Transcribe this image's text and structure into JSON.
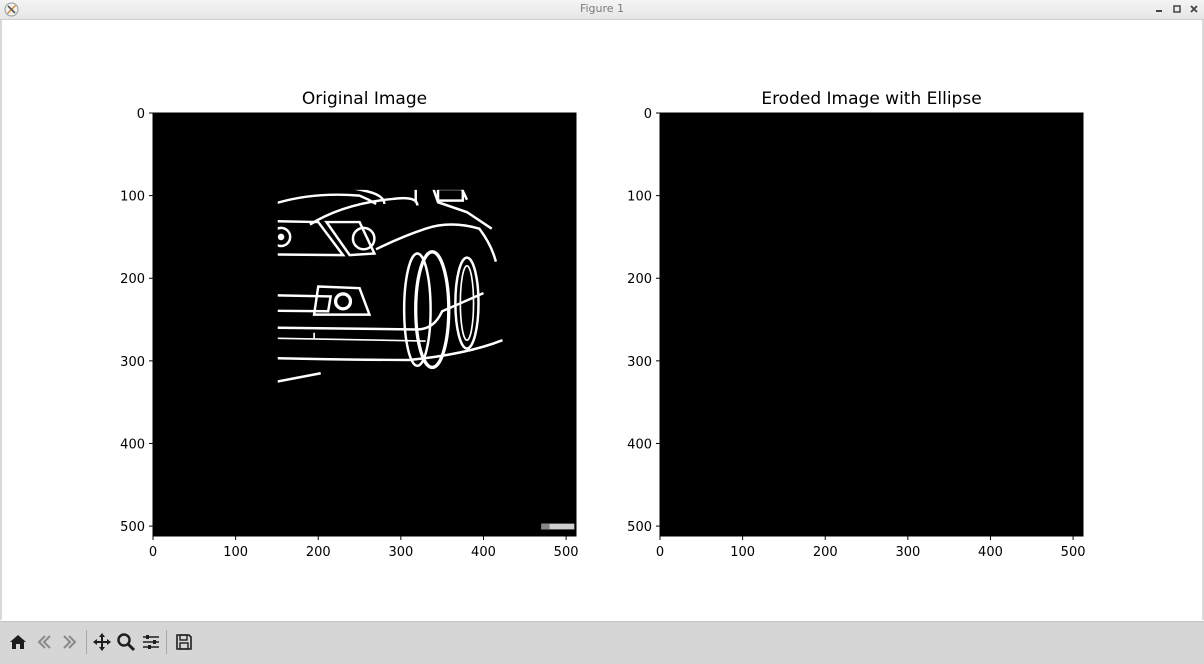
{
  "window": {
    "title": "Figure 1",
    "controls": [
      "minimize-icon",
      "maximize-icon",
      "close-icon"
    ]
  },
  "chart_data": [
    {
      "type": "image",
      "title": "Original Image",
      "xlabel": "",
      "ylabel": "",
      "xlim": [
        0,
        512
      ],
      "ylim": [
        512,
        0
      ],
      "xticks": [
        0,
        100,
        200,
        300,
        400,
        500
      ],
      "yticks": [
        0,
        100,
        200,
        300,
        400,
        500
      ],
      "colormap": "gray"
    },
    {
      "type": "image",
      "title": "Eroded Image with Ellipse",
      "xlabel": "",
      "ylabel": "",
      "xlim": [
        0,
        512
      ],
      "ylim": [
        512,
        0
      ],
      "xticks": [
        0,
        100,
        200,
        300,
        400,
        500
      ],
      "yticks": [
        0,
        100,
        200,
        300,
        400,
        500
      ],
      "colormap": "gray"
    }
  ],
  "toolbar": {
    "buttons": [
      "home-icon",
      "back-icon",
      "forward-icon",
      "pan-icon",
      "zoom-icon",
      "configure-subplots-icon",
      "save-icon"
    ]
  }
}
